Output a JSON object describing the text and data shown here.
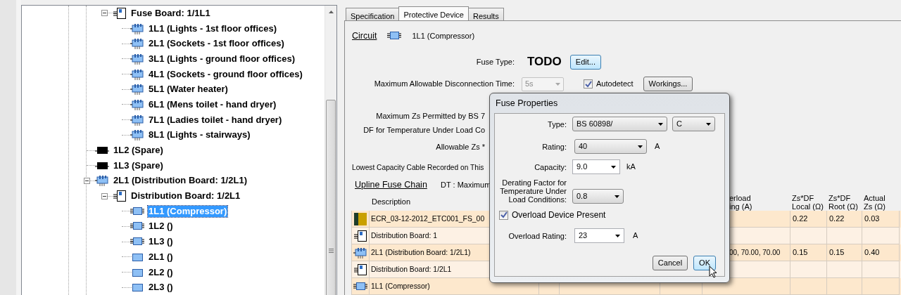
{
  "tree": {
    "items": [
      {
        "children": [
          {
            "kind": "board",
            "label": "Fuse Board: 1/1L1",
            "expanded": true,
            "selected": false,
            "children": [
              {
                "kind": "circuit_board",
                "label": "1L1 (Lights - 1st floor offices)",
                "selected": false
              },
              {
                "kind": "circuit_board",
                "label": "2L1 (Sockets - 1st floor offices)",
                "selected": false
              },
              {
                "kind": "circuit_board",
                "label": "3L1 (Lights - ground floor offices)",
                "selected": false
              },
              {
                "kind": "circuit_board",
                "label": "4L1 (Sockets - ground floor offices)",
                "selected": false
              },
              {
                "kind": "circuit_board",
                "label": "5L1 (Water heater)",
                "selected": false
              },
              {
                "kind": "circuit_board",
                "label": "6L1 (Mens toilet - hand dryer)",
                "selected": false
              },
              {
                "kind": "circuit_board",
                "label": "7L1 (Ladies toilet - hand dryer)",
                "selected": false
              },
              {
                "kind": "circuit_board",
                "label": "8L1 (Lights - stairways)",
                "selected": false
              }
            ]
          }
        ]
      },
      {
        "kind": "spare",
        "label": "1L2 (Spare)",
        "selected": false
      },
      {
        "kind": "spare",
        "label": "1L3 (Spare)",
        "selected": false
      },
      {
        "kind": "circuit_board",
        "label": "2L1 (Distribution Board: 1/2L1)",
        "expanded": true,
        "selected": false,
        "children": [
          {
            "kind": "board",
            "label": "Distribution Board: 1/2L1",
            "expanded": true,
            "selected": false,
            "children": [
              {
                "kind": "circuit",
                "label": "1L1 (Compressor)",
                "selected": true
              },
              {
                "kind": "circuit",
                "label": "1L2 ()",
                "selected": false
              },
              {
                "kind": "circuit",
                "label": "1L3 ()",
                "selected": false
              },
              {
                "kind": "plain",
                "label": "2L1 ()",
                "selected": false
              },
              {
                "kind": "plain",
                "label": "2L2 ()",
                "selected": false
              },
              {
                "kind": "plain",
                "label": "2L3 ()",
                "selected": false
              }
            ]
          }
        ]
      }
    ]
  },
  "tabs": [
    {
      "label": "Specification",
      "selected": false
    },
    {
      "label": "Protective Device",
      "selected": true
    },
    {
      "label": "Results",
      "selected": false
    }
  ],
  "circuit": {
    "label": "Circuit",
    "value": "1L1 (Compressor)"
  },
  "fuse_type": {
    "label": "Fuse Type:",
    "value": "TODO",
    "button": "Edit..."
  },
  "disconnection": {
    "label": "Maximum Allowable Disconnection Time:",
    "value": "5s",
    "disabled": true,
    "autodetect": {
      "label": "Autodetect",
      "checked": true
    },
    "button": "Workings..."
  },
  "partial_labels": [
    "Maximum Zs Permitted by BS 7",
    "DF for Temperature Under Load Co",
    "Allowable Zs *"
  ],
  "lowest_cable_label": "Lowest Capacity Cable Recorded on This",
  "upline": {
    "title": "Upline Fuse Chain",
    "note": "DT : Maximum",
    "columns": {
      "description": "Description",
      "overload": "erload\ning (A)",
      "local": "Zs*DF\nLocal (Ω)",
      "root": "Zs*DF\nRoot (Ω)",
      "actual": "Actual\nZs (Ω)"
    },
    "rows": [
      {
        "kind": "source",
        "description": "ECR_03-12-2012_ETC001_FS_00",
        "local": "0.22",
        "root": "0.22",
        "actual": "0.03"
      },
      {
        "kind": "board",
        "description": "Distribution Board: 1"
      },
      {
        "kind": "circuit_board",
        "description": "2L1 (Distribution Board: 1/2L1)",
        "overload": "00, 70.00, 70.00",
        "local": "0.15",
        "root": "0.15",
        "actual": "0.40"
      },
      {
        "kind": "board",
        "description": "Distribution Board: 1/2L1"
      },
      {
        "kind": "circuit",
        "description": "1L1 (Compressor)"
      }
    ]
  },
  "dialog": {
    "title": "Fuse Properties",
    "type": {
      "label": "Type:",
      "value": "BS 60898/",
      "value2": "C"
    },
    "rating": {
      "label": "Rating:",
      "value": "40",
      "unit": "A"
    },
    "capacity": {
      "label": "Capacity:",
      "value": "9.0",
      "unit": "kA"
    },
    "derating": {
      "label": "Derating Factor for Temperature Under Load Conditions:",
      "value": "0.8"
    },
    "overload_present": {
      "label": "Overload Device Present",
      "checked": true
    },
    "overload_rating": {
      "label": "Overload Rating:",
      "value": "23",
      "unit": "A"
    },
    "buttons": [
      {
        "label": "Cancel",
        "default": false
      },
      {
        "label": "OK",
        "default": true
      }
    ]
  }
}
